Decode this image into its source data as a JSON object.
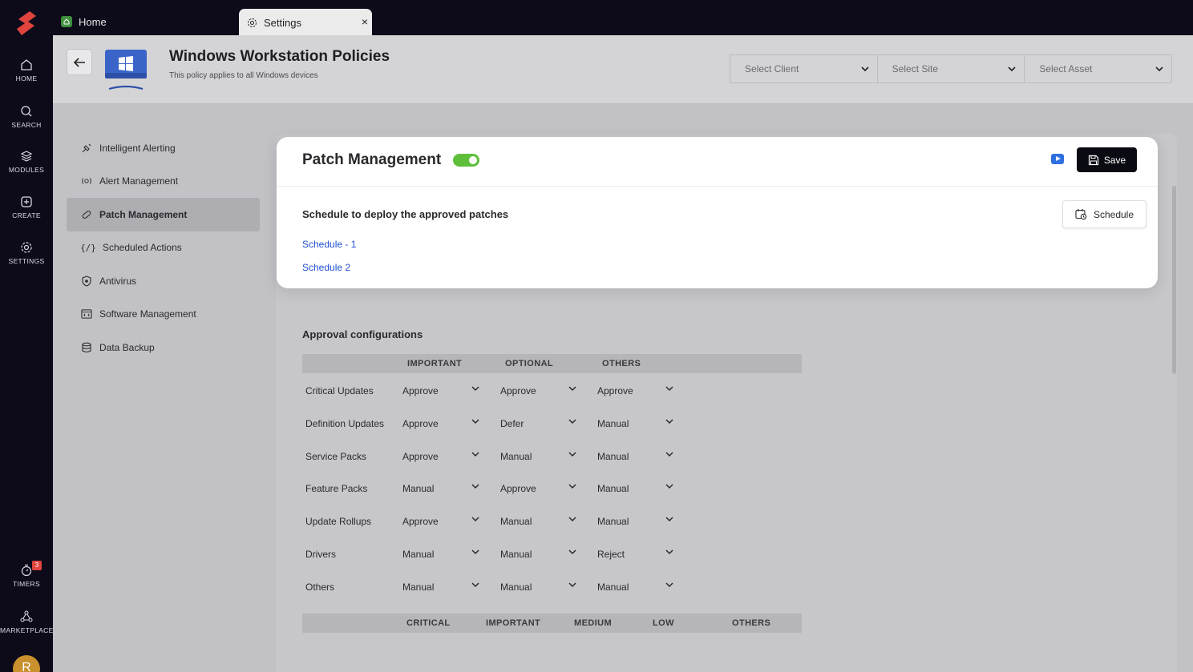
{
  "rail": {
    "items": [
      {
        "label": "HOME",
        "icon": "home-icon"
      },
      {
        "label": "SEARCH",
        "icon": "search-icon"
      },
      {
        "label": "MODULES",
        "icon": "layers-icon"
      },
      {
        "label": "CREATE",
        "icon": "plus-icon"
      },
      {
        "label": "SETTINGS",
        "icon": "gear-icon"
      }
    ],
    "timers_label": "TIMERS",
    "timers_badge": "3",
    "marketplace_label": "MARKETPLACE",
    "avatar_initial": "R"
  },
  "tabs": {
    "home_label": "Home",
    "settings_label": "Settings",
    "close_glyph": "×"
  },
  "header": {
    "title": "Windows Workstation Policies",
    "subtitle": "This policy applies to all Windows devices",
    "select_client": "Select Client",
    "select_site": "Select Site",
    "select_asset": "Select Asset"
  },
  "menu": {
    "items": [
      {
        "label": "Intelligent Alerting",
        "icon": "sparkle-pin-icon"
      },
      {
        "label": "Alert Management",
        "icon": "alert-radio-icon"
      },
      {
        "label": "Patch Management",
        "icon": "bandage-icon",
        "active": true
      },
      {
        "label": "Scheduled Actions",
        "icon": "code-braces-icon"
      },
      {
        "label": "Antivirus",
        "icon": "shield-icon"
      },
      {
        "label": "Software Management",
        "icon": "code-window-icon"
      },
      {
        "label": "Data Backup",
        "icon": "database-icon"
      }
    ]
  },
  "card": {
    "title": "Patch Management",
    "toggle_on": true,
    "save_label": "Save",
    "schedule_heading": "Schedule to deploy the approved patches",
    "schedule_button": "Schedule",
    "schedules": [
      "Schedule - 1",
      "Schedule 2"
    ]
  },
  "approval": {
    "title": "Approval configurations",
    "columns": [
      "IMPORTANT",
      "OPTIONAL",
      "OTHERS"
    ],
    "rows": [
      {
        "label": "Critical Updates",
        "values": [
          "Approve",
          "Approve",
          "Approve"
        ]
      },
      {
        "label": "Definition Updates",
        "values": [
          "Approve",
          "Defer",
          "Manual"
        ]
      },
      {
        "label": "Service Packs",
        "values": [
          "Approve",
          "Manual",
          "Manual"
        ]
      },
      {
        "label": "Feature Packs",
        "values": [
          "Manual",
          "Approve",
          "Manual"
        ]
      },
      {
        "label": "Update Rollups",
        "values": [
          "Approve",
          "Manual",
          "Manual"
        ]
      },
      {
        "label": "Drivers",
        "values": [
          "Manual",
          "Manual",
          "Reject"
        ]
      },
      {
        "label": "Others",
        "values": [
          "Manual",
          "Manual",
          "Manual"
        ]
      }
    ],
    "severity_columns": [
      "CRITICAL",
      "IMPORTANT",
      "MEDIUM",
      "LOW",
      "OTHERS"
    ]
  },
  "colors": {
    "accent_green": "#5fbf3a",
    "link_blue": "#1f4fd1",
    "rail_bg": "#0d0b1a",
    "logo_red": "#e0443c"
  }
}
